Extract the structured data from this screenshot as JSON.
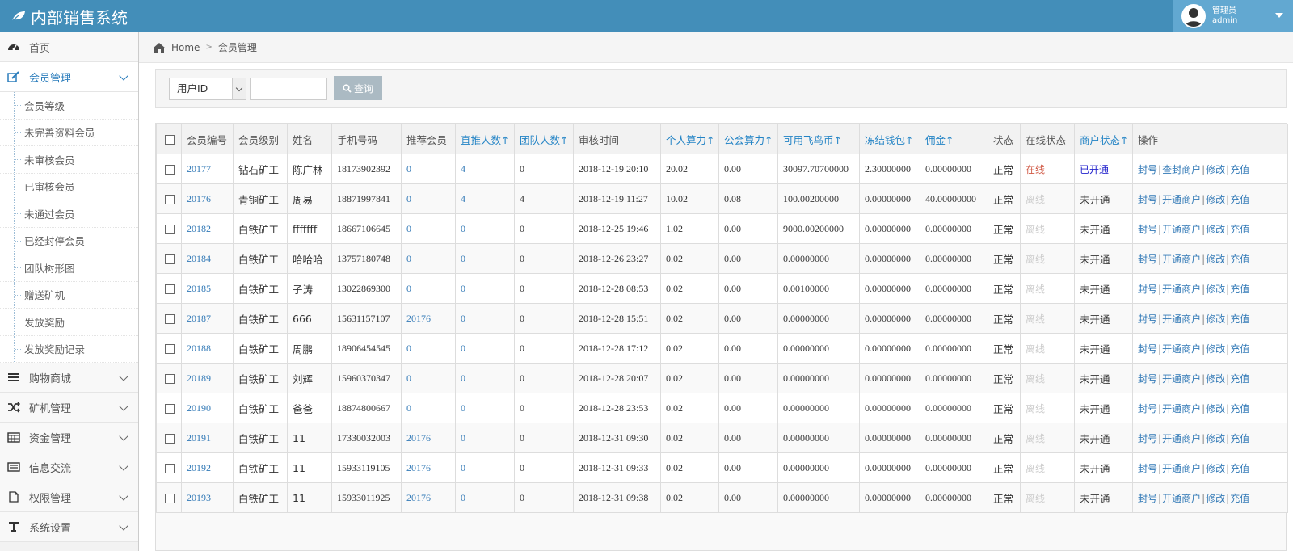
{
  "header": {
    "title": "内部销售系统",
    "user_role": "管理员",
    "user_name": "admin"
  },
  "breadcrumb": {
    "home": "Home",
    "current": "会员管理"
  },
  "sidebar": {
    "items": [
      {
        "label": "首页",
        "icon": "dashboard-icon"
      },
      {
        "label": "会员管理",
        "icon": "edit-icon",
        "active": true,
        "children": [
          "会员等级",
          "未完善资料会员",
          "未审核会员",
          "已审核会员",
          "未通过会员",
          "已经封停会员",
          "团队树形图",
          "赠送矿机",
          "发放奖励",
          "发放奖励记录"
        ]
      },
      {
        "label": "购物商城",
        "icon": "list-icon"
      },
      {
        "label": "矿机管理",
        "icon": "shuffle-icon"
      },
      {
        "label": "资金管理",
        "icon": "calendar-icon"
      },
      {
        "label": "信息交流",
        "icon": "message-icon"
      },
      {
        "label": "权限管理",
        "icon": "file-icon"
      },
      {
        "label": "系统设置",
        "icon": "text-icon"
      }
    ]
  },
  "search": {
    "field_selected": "用户ID",
    "value": "",
    "button": "查询"
  },
  "table": {
    "columns": [
      "会员编号",
      "会员级别",
      "姓名",
      "手机号码",
      "推荐会员",
      "直推人数↑",
      "团队人数↑",
      "审核时间",
      "个人算力↑",
      "公会算力↑",
      "可用飞鸟币↑",
      "冻结钱包↑",
      "佣金↑",
      "状态",
      "在线状态",
      "商户状态↑",
      "操作"
    ],
    "rows": [
      {
        "id": "20177",
        "level": "钻石矿工",
        "name": "陈广林",
        "phone": "18173902392",
        "referrer": "0",
        "direct": "4",
        "team": "0",
        "time": "2018-12-19 20:10",
        "personal": "20.02",
        "guild": "0.00",
        "coin": "30097.70700000",
        "frozen": "2.30000000",
        "commission": "0.00000000",
        "status": "正常",
        "online": "在线",
        "merchant": "已开通",
        "op2": "查封商户"
      },
      {
        "id": "20176",
        "level": "青铜矿工",
        "name": "周易",
        "phone": "18871997841",
        "referrer": "0",
        "direct": "4",
        "team": "4",
        "time": "2018-12-19 11:27",
        "personal": "10.02",
        "guild": "0.08",
        "coin": "100.00200000",
        "frozen": "0.00000000",
        "commission": "40.00000000",
        "status": "正常",
        "online": "离线",
        "merchant": "未开通",
        "op2": "开通商户"
      },
      {
        "id": "20182",
        "level": "白铁矿工",
        "name": "fffffff",
        "phone": "18667106645",
        "referrer": "0",
        "direct": "0",
        "team": "0",
        "time": "2018-12-25 19:46",
        "personal": "1.02",
        "guild": "0.00",
        "coin": "9000.00200000",
        "frozen": "0.00000000",
        "commission": "0.00000000",
        "status": "正常",
        "online": "离线",
        "merchant": "未开通",
        "op2": "开通商户"
      },
      {
        "id": "20184",
        "level": "白铁矿工",
        "name": "哈哈哈",
        "phone": "13757180748",
        "referrer": "0",
        "direct": "0",
        "team": "0",
        "time": "2018-12-26 23:27",
        "personal": "0.02",
        "guild": "0.00",
        "coin": "0.00000000",
        "frozen": "0.00000000",
        "commission": "0.00000000",
        "status": "正常",
        "online": "离线",
        "merchant": "未开通",
        "op2": "开通商户"
      },
      {
        "id": "20185",
        "level": "白铁矿工",
        "name": "子涛",
        "phone": "13022869300",
        "referrer": "0",
        "direct": "0",
        "team": "0",
        "time": "2018-12-28 08:53",
        "personal": "0.02",
        "guild": "0.00",
        "coin": "0.00100000",
        "frozen": "0.00000000",
        "commission": "0.00000000",
        "status": "正常",
        "online": "离线",
        "merchant": "未开通",
        "op2": "开通商户"
      },
      {
        "id": "20187",
        "level": "白铁矿工",
        "name": "666",
        "phone": "15631157107",
        "referrer": "20176",
        "direct": "0",
        "team": "0",
        "time": "2018-12-28 15:51",
        "personal": "0.02",
        "guild": "0.00",
        "coin": "0.00000000",
        "frozen": "0.00000000",
        "commission": "0.00000000",
        "status": "正常",
        "online": "离线",
        "merchant": "未开通",
        "op2": "开通商户"
      },
      {
        "id": "20188",
        "level": "白铁矿工",
        "name": "周鹏",
        "phone": "18906454545",
        "referrer": "0",
        "direct": "0",
        "team": "0",
        "time": "2018-12-28 17:12",
        "personal": "0.02",
        "guild": "0.00",
        "coin": "0.00000000",
        "frozen": "0.00000000",
        "commission": "0.00000000",
        "status": "正常",
        "online": "离线",
        "merchant": "未开通",
        "op2": "开通商户"
      },
      {
        "id": "20189",
        "level": "白铁矿工",
        "name": "刘辉",
        "phone": "15960370347",
        "referrer": "0",
        "direct": "0",
        "team": "0",
        "time": "2018-12-28 20:07",
        "personal": "0.02",
        "guild": "0.00",
        "coin": "0.00000000",
        "frozen": "0.00000000",
        "commission": "0.00000000",
        "status": "正常",
        "online": "离线",
        "merchant": "未开通",
        "op2": "开通商户"
      },
      {
        "id": "20190",
        "level": "白铁矿工",
        "name": "爸爸",
        "phone": "18874800667",
        "referrer": "0",
        "direct": "0",
        "team": "0",
        "time": "2018-12-28 23:53",
        "personal": "0.02",
        "guild": "0.00",
        "coin": "0.00000000",
        "frozen": "0.00000000",
        "commission": "0.00000000",
        "status": "正常",
        "online": "离线",
        "merchant": "未开通",
        "op2": "开通商户"
      },
      {
        "id": "20191",
        "level": "白铁矿工",
        "name": "11",
        "phone": "17330032003",
        "referrer": "20176",
        "direct": "0",
        "team": "0",
        "time": "2018-12-31 09:30",
        "personal": "0.02",
        "guild": "0.00",
        "coin": "0.00000000",
        "frozen": "0.00000000",
        "commission": "0.00000000",
        "status": "正常",
        "online": "离线",
        "merchant": "未开通",
        "op2": "开通商户"
      },
      {
        "id": "20192",
        "level": "白铁矿工",
        "name": "11",
        "phone": "15933119105",
        "referrer": "20176",
        "direct": "0",
        "team": "0",
        "time": "2018-12-31 09:33",
        "personal": "0.02",
        "guild": "0.00",
        "coin": "0.00000000",
        "frozen": "0.00000000",
        "commission": "0.00000000",
        "status": "正常",
        "online": "离线",
        "merchant": "未开通",
        "op2": "开通商户"
      },
      {
        "id": "20193",
        "level": "白铁矿工",
        "name": "11",
        "phone": "15933011925",
        "referrer": "20176",
        "direct": "0",
        "team": "0",
        "time": "2018-12-31 09:38",
        "personal": "0.02",
        "guild": "0.00",
        "coin": "0.00000000",
        "frozen": "0.00000000",
        "commission": "0.00000000",
        "status": "正常",
        "online": "离线",
        "merchant": "未开通",
        "op2": "开通商户"
      }
    ],
    "ops": {
      "ban": "封号",
      "edit": "修改",
      "recharge": "充值"
    }
  },
  "colors": {
    "topbar": "#438eb9",
    "link": "#337ab7",
    "online": "#d15b47",
    "merchant_open": "#2222cc"
  }
}
